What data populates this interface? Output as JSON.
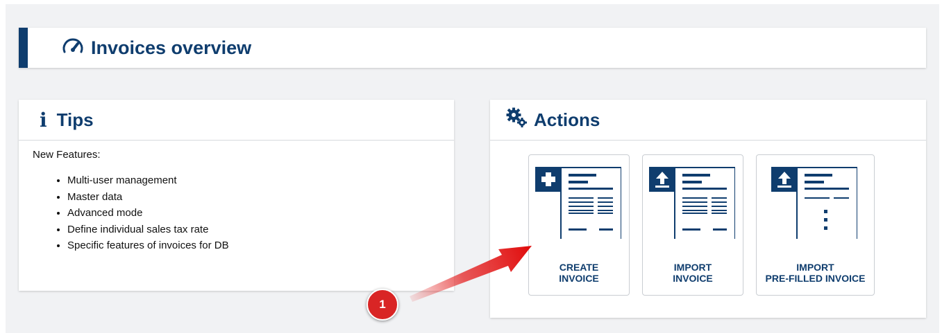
{
  "header": {
    "title": "Invoices overview",
    "icon": "speedometer-icon"
  },
  "tips": {
    "title": "Tips",
    "icon": "info-icon",
    "intro": "New Features:",
    "items": [
      "Multi-user management",
      "Master data",
      "Advanced mode",
      "Define individual sales tax rate",
      "Specific features of invoices for DB"
    ]
  },
  "actions": {
    "title": "Actions",
    "icon": "gears-icon",
    "buttons": [
      {
        "label": "CREATE\nINVOICE",
        "icon": "create-invoice-icon"
      },
      {
        "label": "IMPORT\nINVOICE",
        "icon": "import-invoice-icon"
      },
      {
        "label": "IMPORT\nPRE-FILLED INVOICE",
        "icon": "import-prefilled-invoice-icon"
      }
    ]
  },
  "annotation": {
    "step": "1"
  },
  "colors": {
    "brand": "#0f3d6e",
    "badge": "#d92525",
    "background": "#f1f2f4"
  }
}
